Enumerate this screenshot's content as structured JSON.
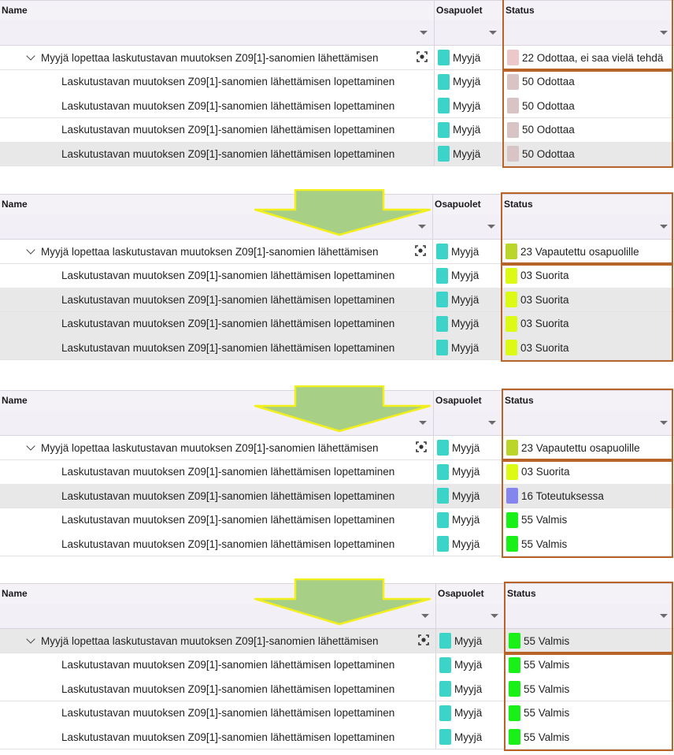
{
  "columns": {
    "name": "Name",
    "parties": "Osapuolet",
    "status": "Status"
  },
  "colors": {
    "party": "#3cd4c8",
    "status_waiting_parent": "#ecc8c8",
    "status_waiting": "#d8c4c4",
    "status_released": "#bcd52a",
    "status_perform": "#dcfa14",
    "status_in_progress": "#8585ee",
    "status_done": "#18f018",
    "highlight_border": "#b86428",
    "arrow_fill": "#a8cf86",
    "arrow_stroke": "#f2f01c"
  },
  "panels": [
    {
      "rows": [
        {
          "name": "Myyjä lopettaa laskutustavan muutoksen Z09[1]-sanomien lähettämisen",
          "party": "Myyjä",
          "status": "22 Odottaa, ei saa vielä tehdä",
          "status_color": "#ecc8c8"
        },
        {
          "name": "Laskutustavan muutoksen Z09[1]-sanomien lähettämisen lopettaminen",
          "party": "Myyjä",
          "status": "50 Odottaa",
          "status_color": "#d8c4c4"
        },
        {
          "name": "Laskutustavan muutoksen Z09[1]-sanomien lähettämisen lopettaminen",
          "party": "Myyjä",
          "status": "50 Odottaa",
          "status_color": "#d8c4c4"
        },
        {
          "name": "Laskutustavan muutoksen Z09[1]-sanomien lähettämisen lopettaminen",
          "party": "Myyjä",
          "status": "50 Odottaa",
          "status_color": "#d8c4c4"
        },
        {
          "name": "Laskutustavan muutoksen Z09[1]-sanomien lähettämisen lopettaminen",
          "party": "Myyjä",
          "status": "50 Odottaa",
          "status_color": "#d8c4c4"
        }
      ]
    },
    {
      "rows": [
        {
          "name": "Myyjä lopettaa laskutustavan muutoksen Z09[1]-sanomien lähettämisen",
          "party": "Myyjä",
          "status": "23 Vapautettu osapuolille",
          "status_color": "#bcd52a"
        },
        {
          "name": "Laskutustavan muutoksen Z09[1]-sanomien lähettämisen lopettaminen",
          "party": "Myyjä",
          "status": "03 Suorita",
          "status_color": "#dcfa14"
        },
        {
          "name": "Laskutustavan muutoksen Z09[1]-sanomien lähettämisen lopettaminen",
          "party": "Myyjä",
          "status": "03 Suorita",
          "status_color": "#dcfa14"
        },
        {
          "name": "Laskutustavan muutoksen Z09[1]-sanomien lähettämisen lopettaminen",
          "party": "Myyjä",
          "status": "03 Suorita",
          "status_color": "#dcfa14"
        },
        {
          "name": "Laskutustavan muutoksen Z09[1]-sanomien lähettämisen lopettaminen",
          "party": "Myyjä",
          "status": "03 Suorita",
          "status_color": "#dcfa14"
        }
      ]
    },
    {
      "rows": [
        {
          "name": "Myyjä lopettaa laskutustavan muutoksen Z09[1]-sanomien lähettämisen",
          "party": "Myyjä",
          "status": "23 Vapautettu osapuolille",
          "status_color": "#bcd52a"
        },
        {
          "name": "Laskutustavan muutoksen Z09[1]-sanomien lähettämisen lopettaminen",
          "party": "Myyjä",
          "status": "03 Suorita",
          "status_color": "#dcfa14"
        },
        {
          "name": "Laskutustavan muutoksen Z09[1]-sanomien lähettämisen lopettaminen",
          "party": "Myyjä",
          "status": "16 Toteutuksessa",
          "status_color": "#8585ee"
        },
        {
          "name": "Laskutustavan muutoksen Z09[1]-sanomien lähettämisen lopettaminen",
          "party": "Myyjä",
          "status": "55 Valmis",
          "status_color": "#18f018"
        },
        {
          "name": "Laskutustavan muutoksen Z09[1]-sanomien lähettämisen lopettaminen",
          "party": "Myyjä",
          "status": "55 Valmis",
          "status_color": "#18f018"
        }
      ]
    },
    {
      "rows": [
        {
          "name": "Myyjä lopettaa laskutustavan muutoksen Z09[1]-sanomien lähettämisen",
          "party": "Myyjä",
          "status": "55 Valmis",
          "status_color": "#18f018"
        },
        {
          "name": "Laskutustavan muutoksen Z09[1]-sanomien lähettämisen lopettaminen",
          "party": "Myyjä",
          "status": "55 Valmis",
          "status_color": "#18f018"
        },
        {
          "name": "Laskutustavan muutoksen Z09[1]-sanomien lähettämisen lopettaminen",
          "party": "Myyjä",
          "status": "55 Valmis",
          "status_color": "#18f018"
        },
        {
          "name": "Laskutustavan muutoksen Z09[1]-sanomien lähettämisen lopettaminen",
          "party": "Myyjä",
          "status": "55 Valmis",
          "status_color": "#18f018"
        },
        {
          "name": "Laskutustavan muutoksen Z09[1]-sanomien lähettämisen lopettaminen",
          "party": "Myyjä",
          "status": "55 Valmis",
          "status_color": "#18f018"
        }
      ]
    }
  ]
}
